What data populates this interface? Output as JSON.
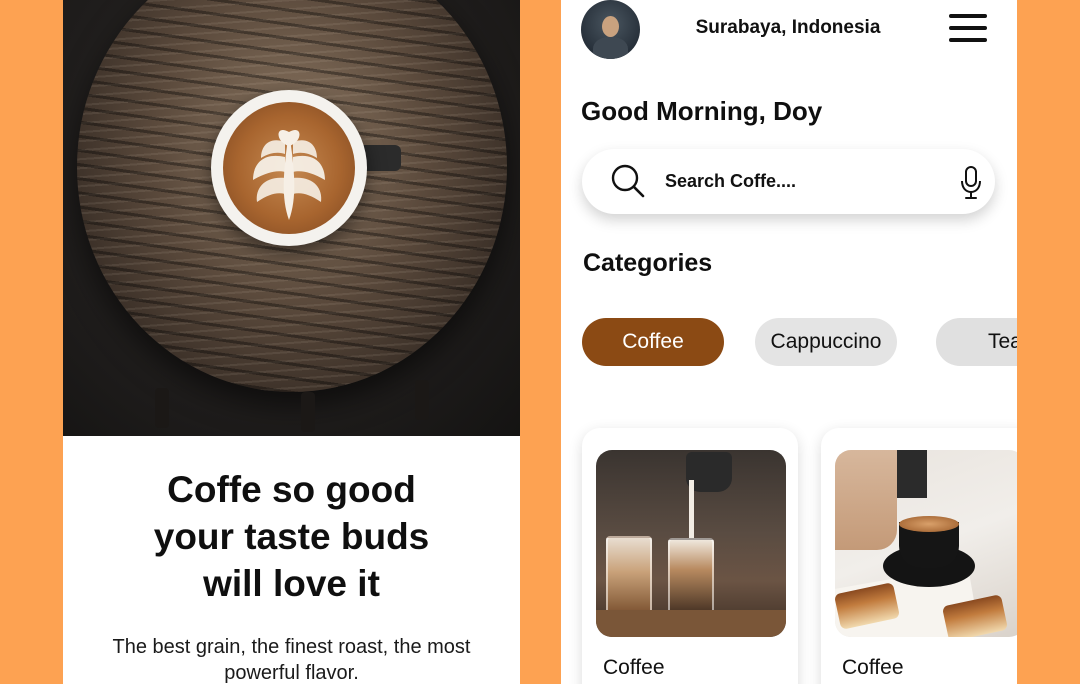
{
  "onboarding": {
    "headline_lines": [
      "Coffe so good",
      "your taste buds",
      "will love it"
    ],
    "subline_lines": [
      "The best grain, the finest roast, the most",
      "powerful flavor."
    ],
    "hero_icon": "latte-art-cup-image"
  },
  "home": {
    "location": "Surabaya, Indonesia",
    "greeting": "Good Morning, Doy",
    "search": {
      "placeholder": "Search Coffe....",
      "icons": [
        "search-icon",
        "microphone-icon"
      ]
    },
    "categories_title": "Categories",
    "categories": [
      {
        "label": "Coffee",
        "selected": true
      },
      {
        "label": "Cappuccino",
        "selected": false
      },
      {
        "label": "Tea",
        "selected": false
      }
    ],
    "products": [
      {
        "name": "Coffee",
        "image": "iced-coffee-image"
      },
      {
        "name": "Coffee",
        "image": "espresso-cup-image"
      }
    ]
  },
  "colors": {
    "background": "#FDA252",
    "accent_brown": "#8B4A14",
    "chip_inactive": "#E4E4E4",
    "text_dark": "#111111"
  }
}
